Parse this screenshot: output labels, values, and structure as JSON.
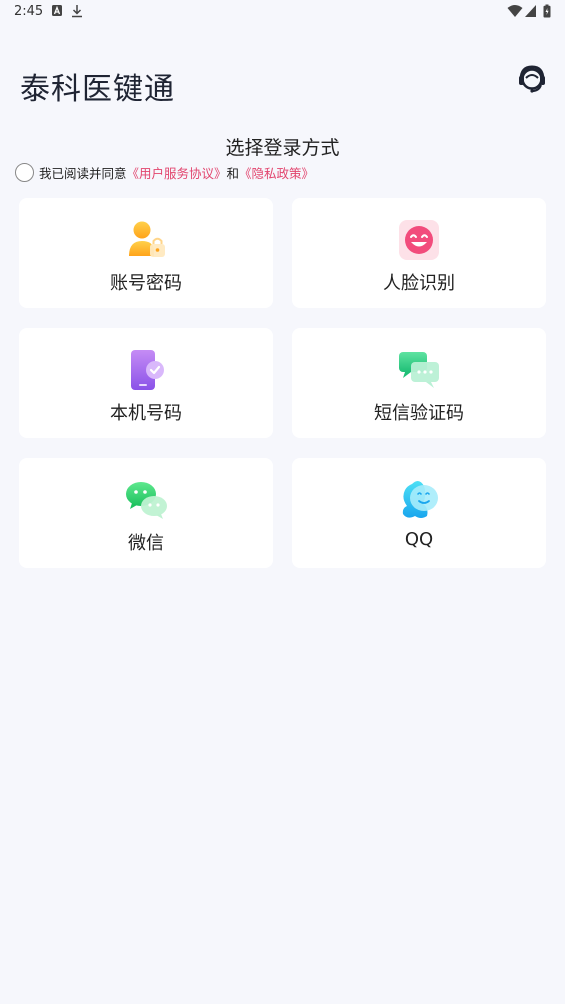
{
  "status_bar": {
    "time": "2:45"
  },
  "header": {
    "title": "泰科医键通"
  },
  "subtitle": "选择登录方式",
  "agreement": {
    "prefix": "我已阅读并同意",
    "terms": "《用户服务协议》",
    "conj": "和",
    "privacy": "《隐私政策》",
    "link_color": "#e2456e"
  },
  "login_methods": [
    {
      "label": "账号密码",
      "icon": "user-lock-icon"
    },
    {
      "label": "人脸识别",
      "icon": "face-icon"
    },
    {
      "label": "本机号码",
      "icon": "phone-check-icon"
    },
    {
      "label": "短信验证码",
      "icon": "sms-icon"
    },
    {
      "label": "微信",
      "icon": "wechat-icon"
    },
    {
      "label": "QQ",
      "icon": "qq-icon"
    }
  ]
}
